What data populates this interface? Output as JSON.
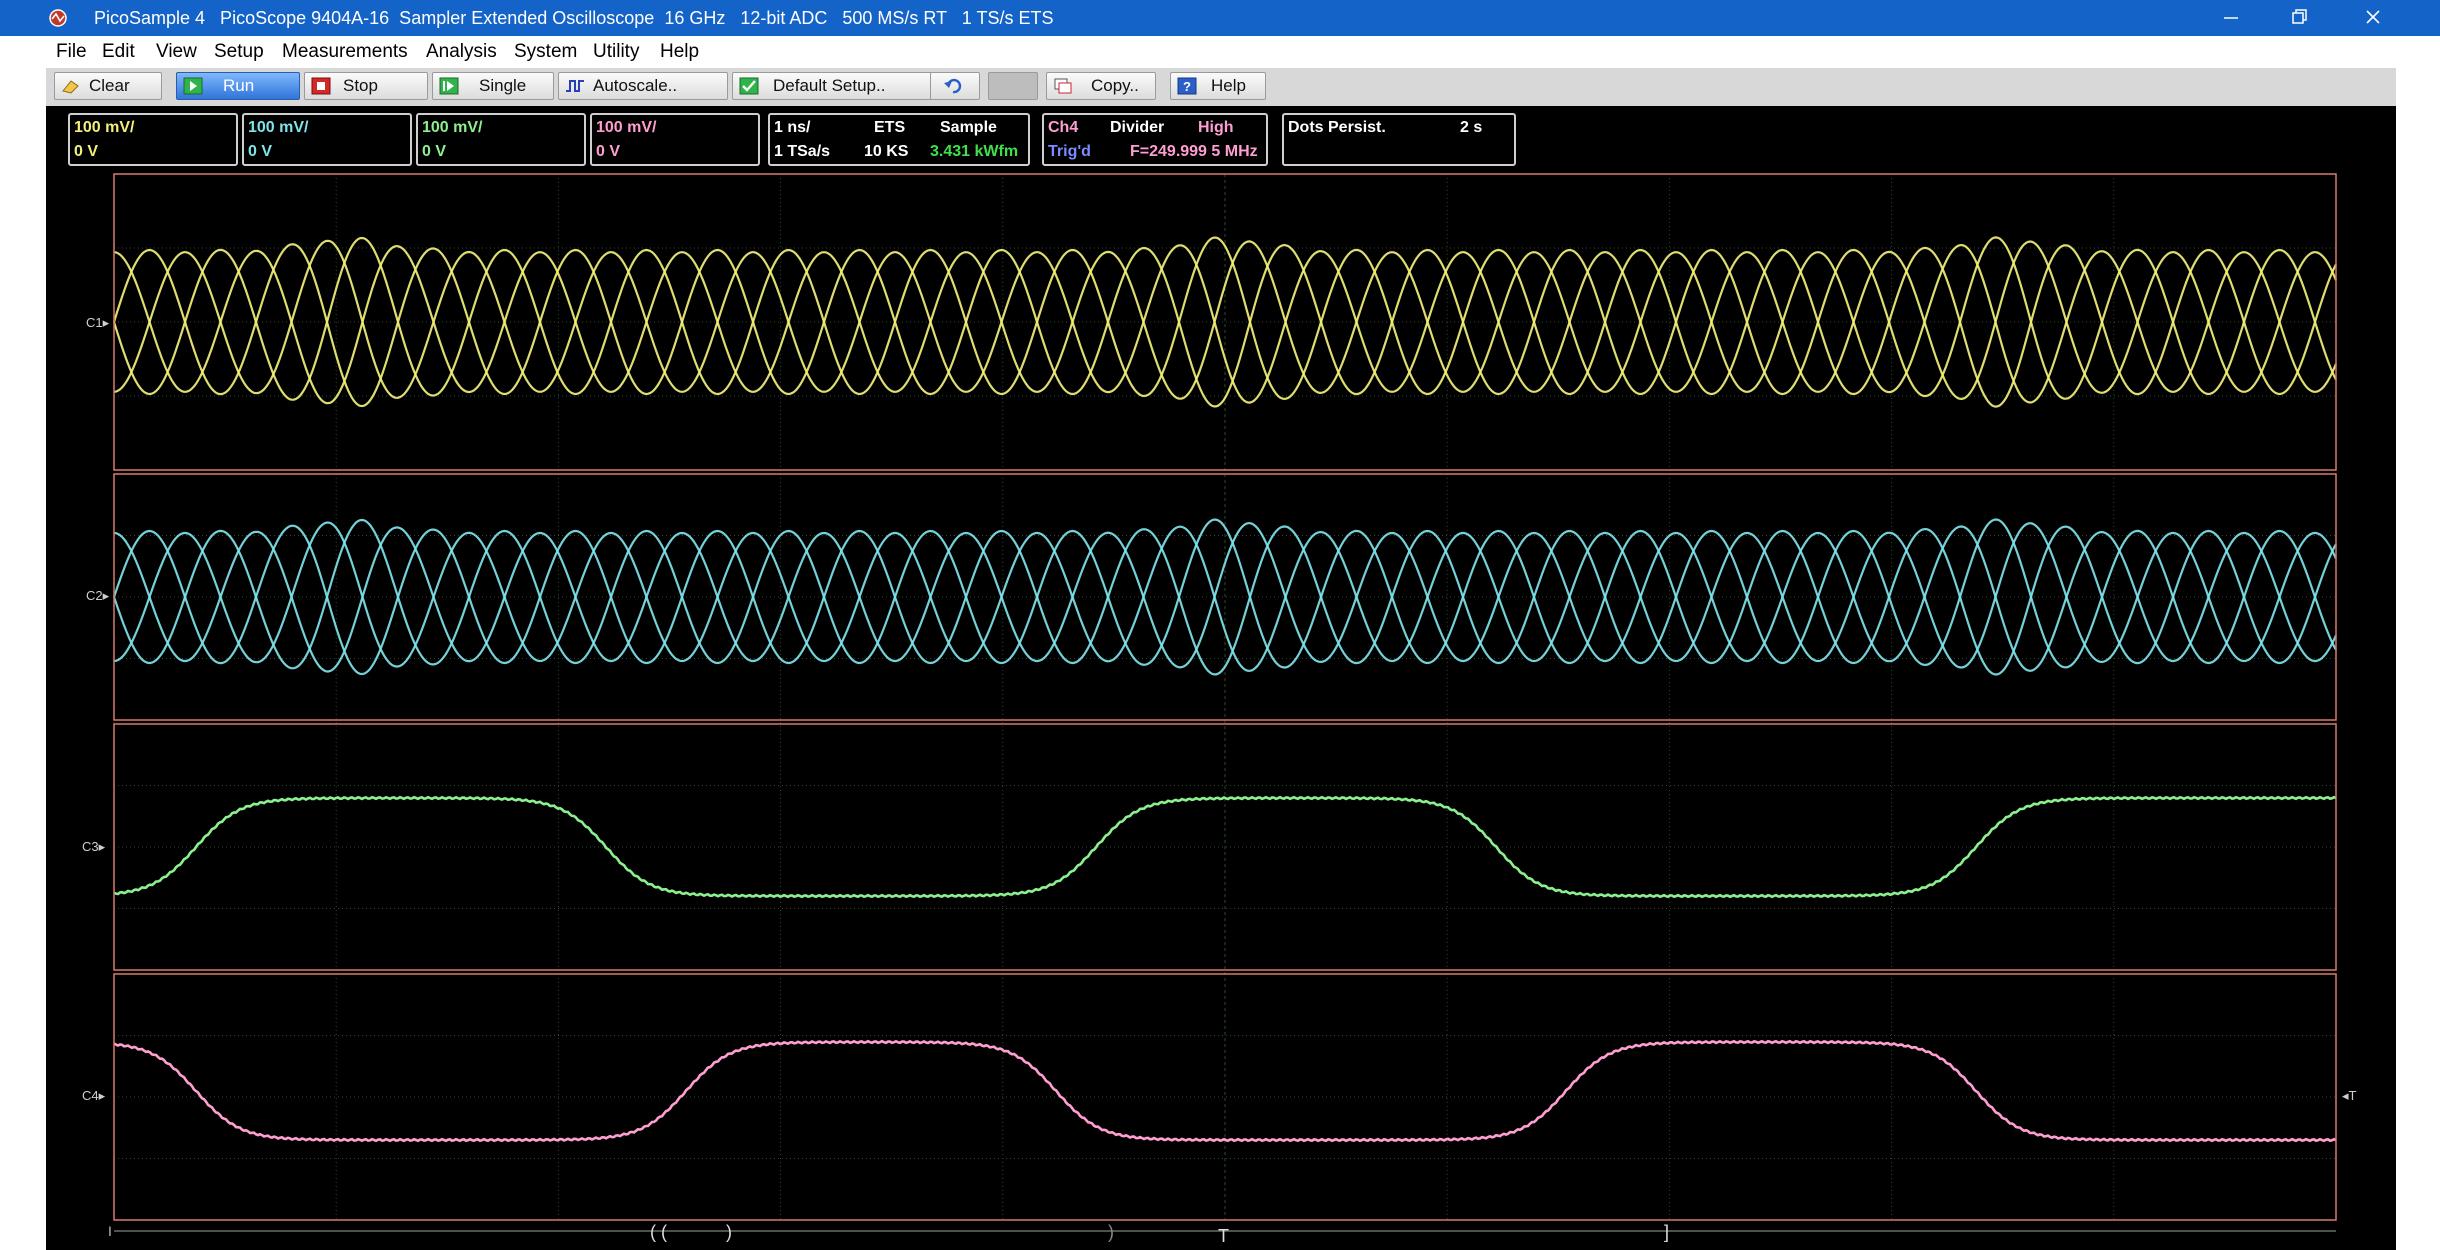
{
  "window": {
    "title": "PicoSample 4   PicoScope 9404A-16  Sampler Extended Oscilloscope  16 GHz   12-bit ADC   500 MS/s RT   1 TS/s ETS"
  },
  "menu": [
    "File",
    "Edit",
    "View",
    "Setup",
    "Measurements",
    "Analysis",
    "System",
    "Utility",
    "Help"
  ],
  "toolbar": {
    "clear": "Clear",
    "run": "Run",
    "stop": "Stop",
    "single": "Single",
    "autoscale": "Autoscale..",
    "default_setup": "Default Setup..",
    "copy": "Copy..",
    "help": "Help"
  },
  "channels": [
    {
      "id": "C1",
      "scale": "100 mV/",
      "offset": "0 V",
      "color": "#f2f07a"
    },
    {
      "id": "C2",
      "scale": "100 mV/",
      "offset": "0 V",
      "color": "#7fe3ea"
    },
    {
      "id": "C3",
      "scale": "100 mV/",
      "offset": "0 V",
      "color": "#8df08f"
    },
    {
      "id": "C4",
      "scale": "100 mV/",
      "offset": "0 V",
      "color": "#ff9ed0"
    }
  ],
  "timebase": {
    "time_per_div": "1 ns/",
    "mode": "ETS",
    "acq": "Sample",
    "sample_rate": "1 TSa/s",
    "length": "10 KS",
    "waveform_rate": "3.431 kWfm"
  },
  "trigger": {
    "source": "Ch4",
    "type": "Divider",
    "level": "High",
    "status": "Trig'd",
    "frequency": "F=249.999 5 MHz"
  },
  "display": {
    "persist_mode": "Dots Persist.",
    "persist_time": "2 s"
  },
  "markers": {
    "trigger": "T",
    "paren_open": "( (",
    "paren_close": ")",
    "paren_close2": ")",
    "bracket": "]"
  },
  "colors": {
    "titlebar": "#1463c8",
    "grid": "#2b4a2b",
    "panel_border": "#d97a6a"
  }
}
